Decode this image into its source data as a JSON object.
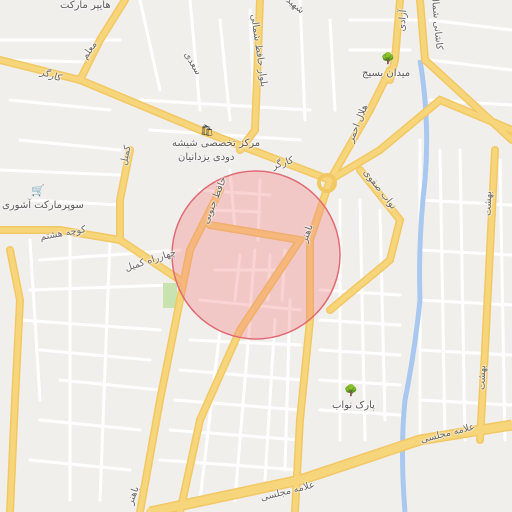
{
  "map": {
    "pois": {
      "glass_center": {
        "line1": "مرکز تخصصی شیشه",
        "line2": "دودی یزدانیان",
        "icon": "shopping-bag-icon"
      },
      "supermarket_ashouri": {
        "label": "سوپرمارکت آشوری",
        "icon": "cart-icon"
      },
      "hyper_market": {
        "label": "هایپر مارکت"
      },
      "park_navab": {
        "label": "پارک نواب",
        "icon": "tree-icon"
      },
      "meydan_basij": {
        "label": "میدان بسیج",
        "icon": "tree-icon"
      }
    },
    "roads": {
      "kargar_w": "کارگر",
      "kargar_e": "کارگر",
      "moallem": "معلم",
      "saadi": "سعدی",
      "hafez_shomali": "بلوار حافظ شمالی",
      "hafez_jonubi": "حافظ جنوبی",
      "kamil_n": "کمیل",
      "chaharrah_kamil": "چهارراه کمیل",
      "kucheh_hashtom": "کوچه هشتم",
      "helal_ahmar": "هلال احمر",
      "abuzar_safavi": "نواب صفوی",
      "bahonar_n": "باهنر",
      "bahonar_s": "باهنر",
      "allameh_majlesi_1": "علامه مجلسی",
      "allameh_majlesi_2": "علامه مجلسی",
      "azadi": "آزادی",
      "kashani_shomali": "کاشانی شمالی",
      "behesht_1": "بهشت",
      "behesht_2": "بهشت",
      "shahid_top": "شهید"
    },
    "highlight_circle": {
      "color": "#f08080"
    },
    "colors": {
      "background": "#f1efec",
      "major_road": "#f7d57a",
      "minor_road": "#ffffff",
      "water": "#a9c8f0",
      "park": "#c9e3b0"
    }
  }
}
